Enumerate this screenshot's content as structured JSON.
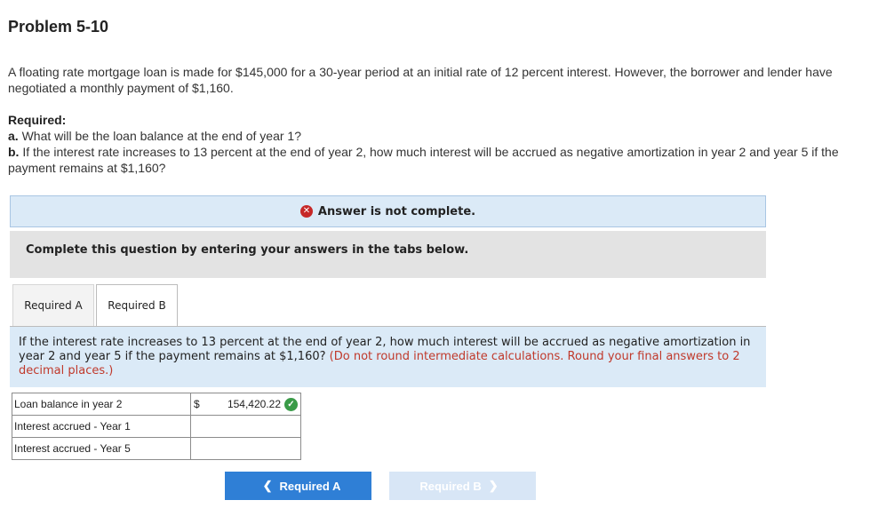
{
  "title": "Problem 5-10",
  "intro": "A floating rate mortgage loan is made for $145,000 for a 30-year period at an initial rate of 12 percent interest. However, the borrower and lender have negotiated a monthly payment of $1,160.",
  "required": {
    "heading": "Required:",
    "a_label": "a.",
    "a_text": " What will be the loan balance at the end of year 1?",
    "b_label": "b.",
    "b_text": " If the interest rate increases to 13 percent at the end of year 2, how much interest will be accrued as negative amortization in year 2 and year 5 if the payment remains at $1,160?"
  },
  "banner": {
    "text": "Answer is not complete.",
    "icon": "x-circle-icon",
    "color": "#c62828"
  },
  "instruction": "Complete this question by entering your answers in the tabs below.",
  "tabs": [
    {
      "label": "Required A",
      "active": false
    },
    {
      "label": "Required B",
      "active": true
    }
  ],
  "question": {
    "text": "If the interest rate increases to 13 percent at the end of year 2, how much interest will be accrued as negative amortization in year 2 and year 5 if the payment remains at $1,160?",
    "note": "(Do not round intermediate calculations. Round your final answers to 2 decimal places.)"
  },
  "answers": {
    "rows": [
      {
        "label": "Loan balance in year 2",
        "currency": "$",
        "value": "154,420.22",
        "status": "correct"
      },
      {
        "label": "Interest accrued - Year 1",
        "currency": "",
        "value": "",
        "status": ""
      },
      {
        "label": "Interest accrued - Year 5",
        "currency": "",
        "value": "",
        "status": ""
      }
    ]
  },
  "nav": {
    "prev_label": "Required A",
    "next_label": "Required B",
    "prev_icon": "chevron-left-icon",
    "next_icon": "chevron-right-icon",
    "accent": "#2f7fd6"
  }
}
